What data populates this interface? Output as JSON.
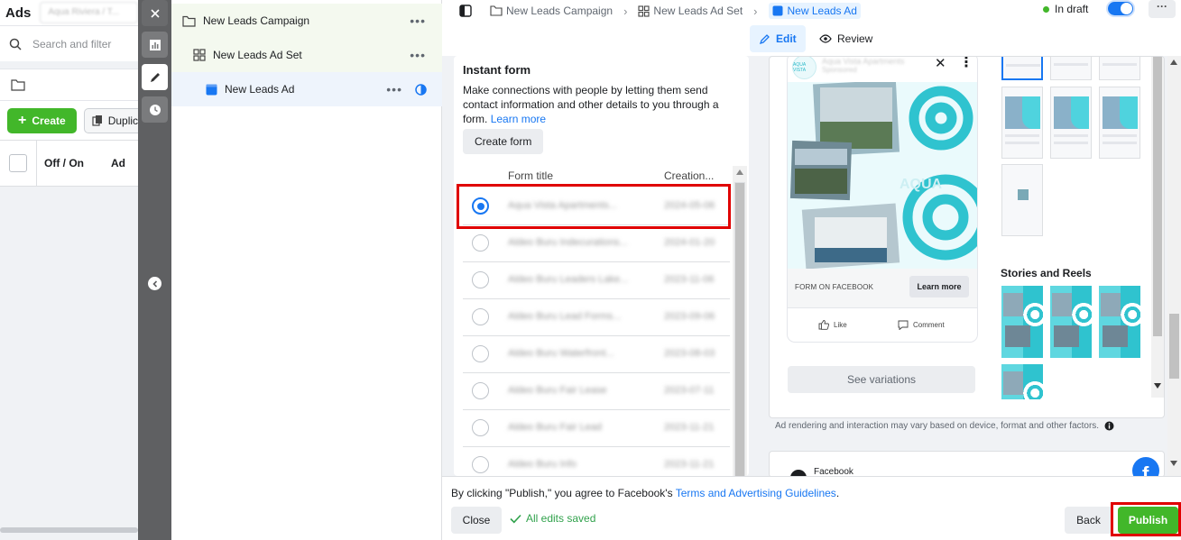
{
  "left_panel": {
    "title": "Ads",
    "account_name": "Aqua Riviera / T...",
    "search_placeholder": "Search and filter",
    "create_label": "Create",
    "duplicate_label": "Duplic",
    "col_off_on": "Off / On",
    "col_ad": "Ad"
  },
  "tree": {
    "campaign": "New Leads Campaign",
    "ad_set": "New Leads Ad Set",
    "ad": "New Leads Ad",
    "more": "•••"
  },
  "breadcrumb": {
    "campaign": "New Leads Campaign",
    "ad_set": "New Leads Ad Set",
    "ad": "New Leads Ad",
    "status": "In draft",
    "more": "···"
  },
  "tabs": {
    "edit": "Edit",
    "review": "Review"
  },
  "instant_form": {
    "heading": "Instant form",
    "description": "Make connections with people by letting them send contact information and other details to you through a form.",
    "learn_more": "Learn more",
    "create_form": "Create form",
    "col_title": "Form title",
    "col_created": "Creation...",
    "rows": [
      {
        "title": "Aqua Vista Apartments...",
        "date": "2024-05-06",
        "selected": true
      },
      {
        "title": "Aldeo Buru Indecurations...",
        "date": "2024-01-20",
        "selected": false
      },
      {
        "title": "Aldeo Buru Leaders Lake...",
        "date": "2023-11-06",
        "selected": false
      },
      {
        "title": "Aldeo Buru Lead Forms...",
        "date": "2023-09-06",
        "selected": false
      },
      {
        "title": "Aldeo Buru Waterfront...",
        "date": "2023-08-03",
        "selected": false
      },
      {
        "title": "Aldeo Buru Fair Lease",
        "date": "2023-07-11",
        "selected": false
      },
      {
        "title": "Aldeo Buru Fair Lead",
        "date": "2023-11-21",
        "selected": false
      },
      {
        "title": "Aldeo Buru Info",
        "date": "2023-11-21",
        "selected": false
      }
    ]
  },
  "preview": {
    "brand": "Aqua Vista Apartments",
    "sponsored": "Sponsored",
    "logo_text": "AQUA VISTA",
    "cta_caption": "FORM ON FACEBOOK",
    "cta_button": "Learn more",
    "like": "Like",
    "comment": "Comment",
    "see_variations": "See variations",
    "stories_heading": "Stories and Reels",
    "disclaimer": "Ad rendering and interaction may vary based on device, format and other factors.",
    "facebook_label": "Facebook"
  },
  "footer": {
    "agree_prefix": "By clicking \"Publish,\" you agree to Facebook's ",
    "agree_link": "Terms and Advertising Guidelines",
    "agree_suffix": ".",
    "close": "Close",
    "saved": "All edits saved",
    "back": "Back",
    "publish": "Publish"
  },
  "colors": {
    "accent": "#1877f2",
    "green": "#42b72a",
    "highlight": "#e00000"
  }
}
